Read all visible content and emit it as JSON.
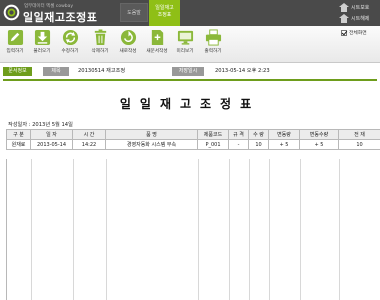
{
  "header": {
    "subtitle": "업무데이터 엑셀 cowbay",
    "title": "일일재고조정표",
    "help_tab": "도움말",
    "active_tab_line1": "일일재고",
    "active_tab_line2": "조정표",
    "sheet_protect": "시트보호",
    "sheet_unprotect": "시트해제"
  },
  "toolbar": {
    "items": [
      {
        "label": "입력하기",
        "icon": "pencil-icon"
      },
      {
        "label": "불러오기",
        "icon": "download-icon"
      },
      {
        "label": "수정하기",
        "icon": "refresh-icon"
      },
      {
        "label": "삭제하기",
        "icon": "trash-icon"
      },
      {
        "label": "새로작성",
        "icon": "new-document-icon"
      },
      {
        "label": "새문서작성",
        "icon": "new-file-icon"
      },
      {
        "label": "미리보기",
        "icon": "monitor-icon"
      },
      {
        "label": "출력하기",
        "icon": "printer-icon"
      }
    ],
    "fullscreen": "전체화면"
  },
  "info": {
    "doc_info_label": "문서정보",
    "subject_label": "제목",
    "subject_value": "20130514 재고조정",
    "saved_label": "저장일시",
    "saved_value": "2013-05-14  오후 2:23"
  },
  "document": {
    "title": "일일재고조정표",
    "writer": "작성일자 : 2013년 5월 14일",
    "headers": [
      "구 분",
      "일 자",
      "시 간",
      "품    명",
      "제품코드",
      "규 격",
      "수 량",
      "변동량",
      "변동수량",
      "전 재"
    ],
    "rows": [
      [
        "원재료",
        "2013-05-14",
        "14:22",
        "경영자동화 시스템 부속",
        "P_001",
        "-",
        "10",
        "+ 5",
        "+ 5",
        "10"
      ]
    ]
  },
  "colors": {
    "header_bg": "#4a4a4a",
    "accent_green": "#8fbf16",
    "label_green": "#6e9d1c"
  }
}
